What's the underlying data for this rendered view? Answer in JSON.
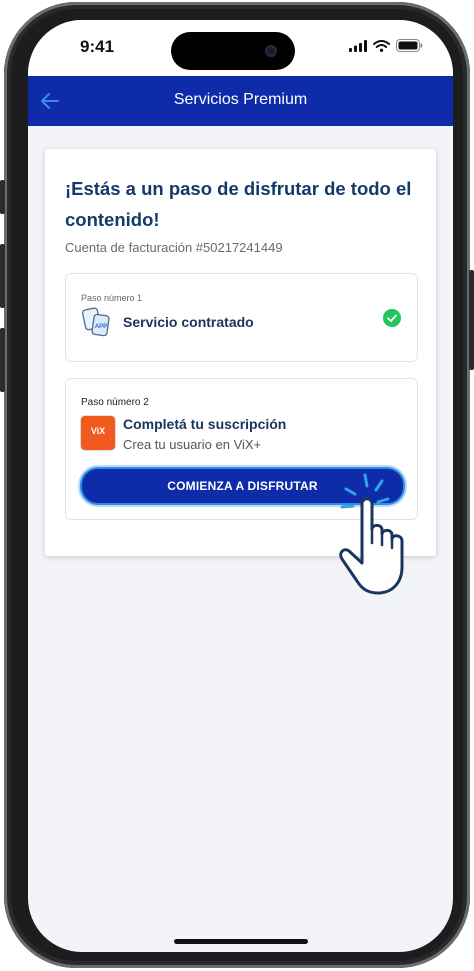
{
  "status_bar": {
    "time": "9:41"
  },
  "app_bar": {
    "title": "Servicios Premium",
    "back_icon": "arrow-left-icon"
  },
  "card": {
    "headline": "¡Estás a un paso de disfrutar de todo el contenido!",
    "account": "Cuenta de facturación #50217241449",
    "steps": [
      {
        "number_label": "Paso número 1",
        "title": "Servicio contratado",
        "status": "completed",
        "icon": "app-stack-icon"
      },
      {
        "number_label": "Paso número 2",
        "title": "Completá tu suscripción",
        "subtitle": "Crea tu usuario en ViX+",
        "icon": "vix-logo",
        "logo_text": "ViX",
        "button_label": "COMIENZA A DISFRUTAR"
      }
    ]
  },
  "colors": {
    "primary": "#0e2baa",
    "headline": "#143a6b",
    "success": "#22c55e",
    "accent_glow": "#2f8de4",
    "vix": "#f05a1f"
  }
}
